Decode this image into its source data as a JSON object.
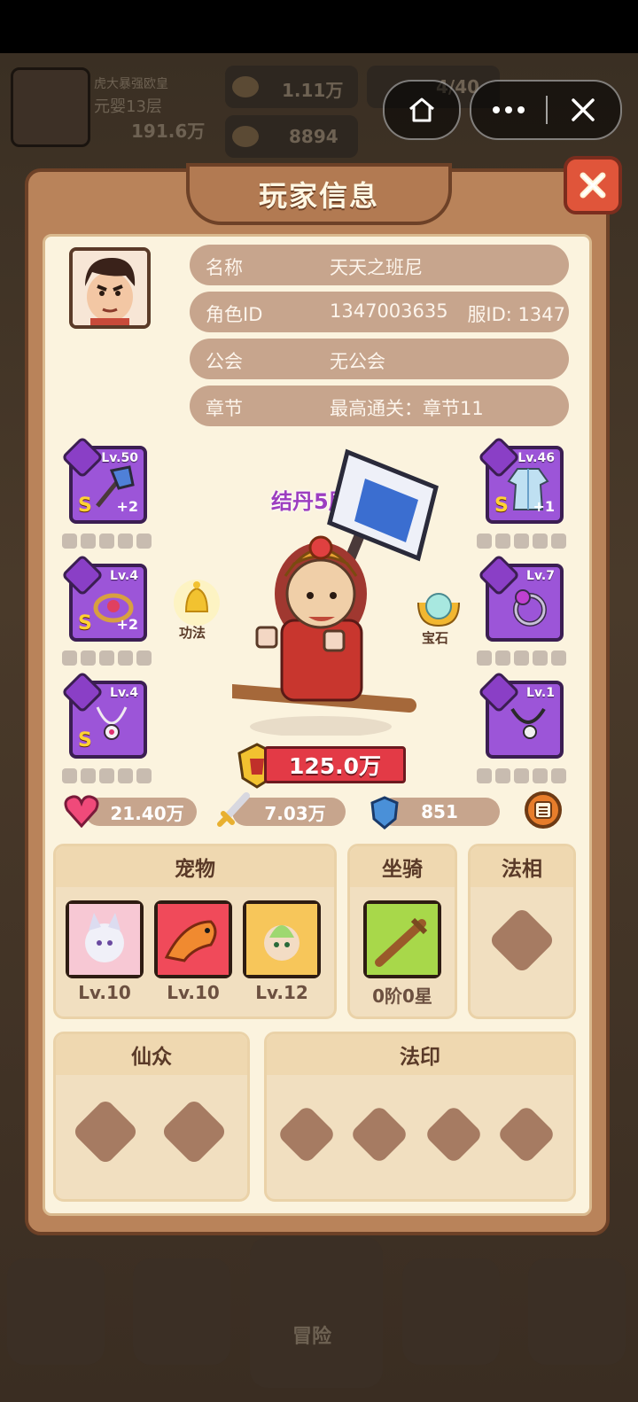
{
  "background": {
    "player_name": "虎大暴强欧皇",
    "player_sub": "元婴13层",
    "power": "191.6万",
    "food": "1.11万",
    "gems": "8894",
    "stamina": "4/40",
    "adventure": "冒险"
  },
  "capsule": {
    "home_icon": "home-icon",
    "more_icon": "more-icon",
    "close_icon": "close-icon"
  },
  "panel": {
    "title": "玩家信息",
    "info": {
      "name_label": "名称",
      "name_value": "天天之班尼",
      "id_label": "角色ID",
      "id_value": "1347003635",
      "server_value": "服ID: 1347",
      "guild_label": "公会",
      "guild_value": "无公会",
      "chapter_label": "章节",
      "chapter_value": "最高通关：章节11"
    },
    "equipment_left": [
      {
        "lv": "Lv.50",
        "grade": "S",
        "plus": "+2",
        "icon": "axe-icon"
      },
      {
        "lv": "Lv.4",
        "grade": "S",
        "plus": "+2",
        "icon": "amulet-icon"
      },
      {
        "lv": "Lv.4",
        "grade": "S",
        "plus": "",
        "icon": "necklace-icon"
      }
    ],
    "equipment_right": [
      {
        "lv": "Lv.46",
        "grade": "S",
        "plus": "+1",
        "icon": "robe-icon"
      },
      {
        "lv": "Lv.7",
        "grade": "",
        "plus": "",
        "icon": "ring-icon"
      },
      {
        "lv": "Lv.1",
        "grade": "",
        "plus": "",
        "icon": "pendant-icon"
      }
    ],
    "skill_label": "功法",
    "gem_label": "宝石",
    "realm": "结丹5层",
    "power": "125.0万",
    "stats": {
      "hp": "21.40万",
      "attack": "7.03万",
      "defense": "851"
    },
    "sections": {
      "pets_title": "宠物",
      "pets": [
        {
          "lv": "Lv.10"
        },
        {
          "lv": "Lv.10"
        },
        {
          "lv": "Lv.12"
        }
      ],
      "mount_title": "坐骑",
      "mount_value": "0阶0星",
      "dharma_title": "法相",
      "immortals_title": "仙众",
      "seals_title": "法印"
    }
  },
  "colors": {
    "panel": "#b9835a",
    "inner": "#fbf3de",
    "purple_slot": "#9c55d8",
    "red_banner": "#e33a46"
  }
}
